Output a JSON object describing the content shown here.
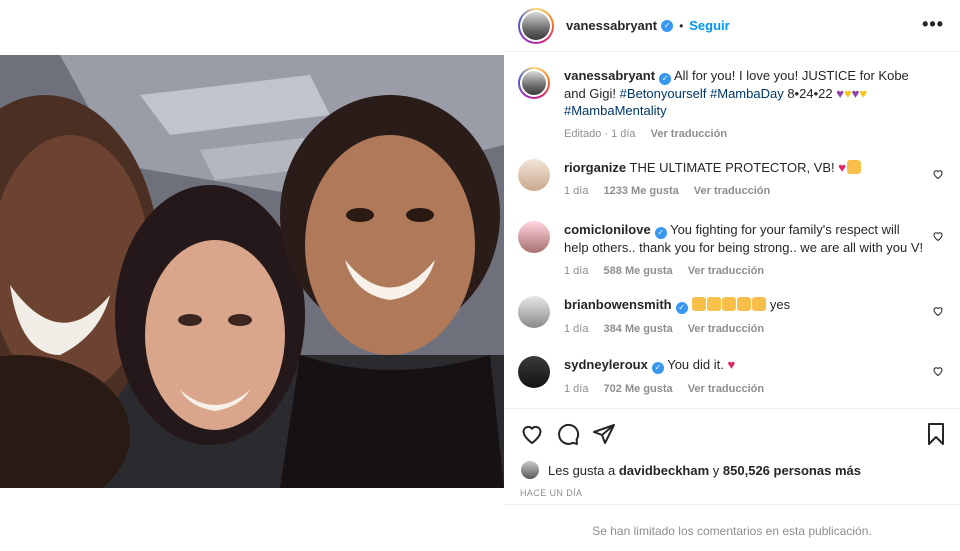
{
  "post": {
    "username": "vanessabryant",
    "follow_label": "Seguir",
    "dot": "•",
    "more": "•••"
  },
  "caption": {
    "username": "vanessabryant",
    "text": "All for you! I love you! JUSTICE for Kobe and Gigi!",
    "hashtags": "#Betonyourself #MambaDay",
    "date": "8•24•22",
    "hashtag2": "#MambaMentality",
    "edited": "Editado · 1 día",
    "translate": "Ver traducción"
  },
  "comments": [
    {
      "username": "riorganize",
      "text": "THE ULTIMATE PROTECTOR, VB!",
      "time": "1 día",
      "likes": "1233 Me gusta",
      "translate": "Ver traducción"
    },
    {
      "username": "comicloni love",
      "username_display": "comicIonilove",
      "text": "You fighting for your family's respect will help others.. thank you for being strong.. we are all with you V!",
      "time": "1 día",
      "likes": "588 Me gusta",
      "translate": "Ver traducción"
    },
    {
      "username": "brianbowensmith",
      "text": "yes",
      "time": "1 día",
      "likes": "384 Me gusta",
      "translate": "Ver traducción"
    },
    {
      "username": "sydneyleroux",
      "text": "You did it.",
      "time": "1 día",
      "likes": "702 Me gusta",
      "translate": "Ver traducción"
    }
  ],
  "likes_line": {
    "prefix": "Les gusta a",
    "user": "davidbeckham",
    "mid": "y",
    "count": "850,526 personas más"
  },
  "timeago": "HACE UN DÍA",
  "limited": "Se han limitado los comentarios en esta publicación.",
  "icons": {
    "like": "heart-icon",
    "comment": "comment-icon",
    "share": "share-icon",
    "save": "bookmark-icon"
  },
  "colors": {
    "link": "#00376b",
    "follow": "#0095f6",
    "muted": "#8e8e8e"
  }
}
